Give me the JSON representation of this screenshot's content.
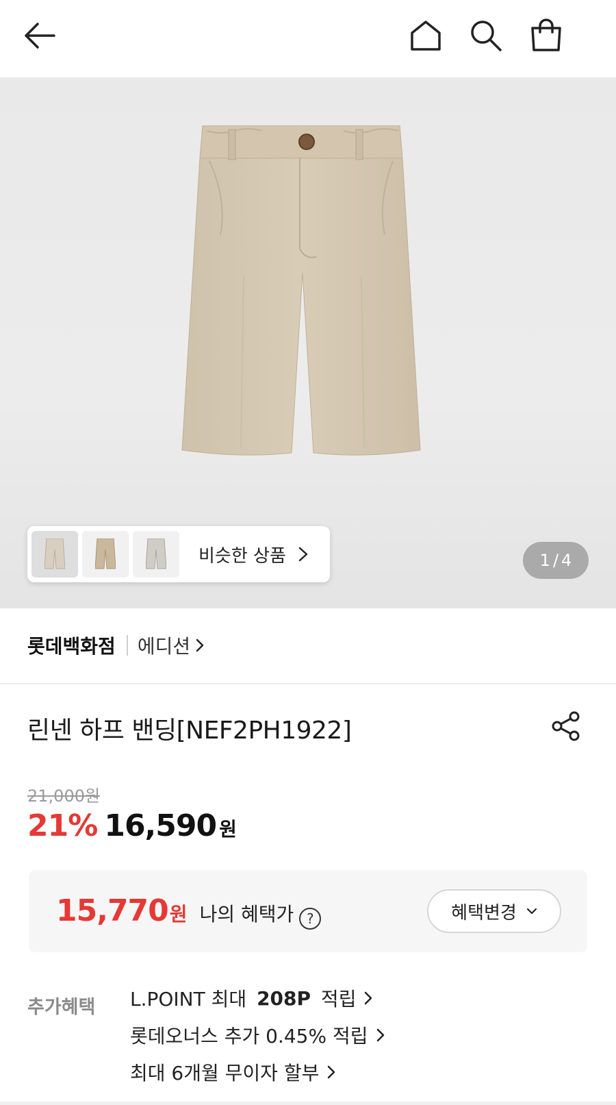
{
  "header": {
    "back_icon": "arrow-left-icon",
    "home_icon": "home-icon",
    "search_icon": "search-icon",
    "cart_icon": "shopping-bag-icon"
  },
  "gallery": {
    "image_subject": "beige-shorts",
    "thumbnail_colors": [
      "#d9cfc0",
      "#cbb79c",
      "#d0ccc6"
    ],
    "similar_label": "비슷한 상품",
    "pager_current": "1",
    "pager_sep": "/",
    "pager_total": "4"
  },
  "brand": {
    "name": "롯데백화점",
    "sub": "에디션"
  },
  "product": {
    "title": "린넨 하프 밴딩[NEF2PH1922]",
    "original_price": "21,000원",
    "discount": "21%",
    "sale_price": "16,590",
    "sale_unit": "원"
  },
  "benefit": {
    "price": "15,770",
    "unit": "원",
    "label": "나의 혜택가",
    "help": "?",
    "change_label": "혜택변경"
  },
  "extra": {
    "label": "추가혜택",
    "items": [
      {
        "pre": "L.POINT 최대 ",
        "bold": "208P",
        "post": " 적립"
      },
      {
        "pre": "롯데오너스 추가 0.45% 적립",
        "bold": "",
        "post": ""
      },
      {
        "pre": "최대 6개월 무이자 할부",
        "bold": "",
        "post": ""
      }
    ]
  },
  "colors": {
    "accent_red": "#e53935",
    "product_beige": "#d8cbb6"
  }
}
